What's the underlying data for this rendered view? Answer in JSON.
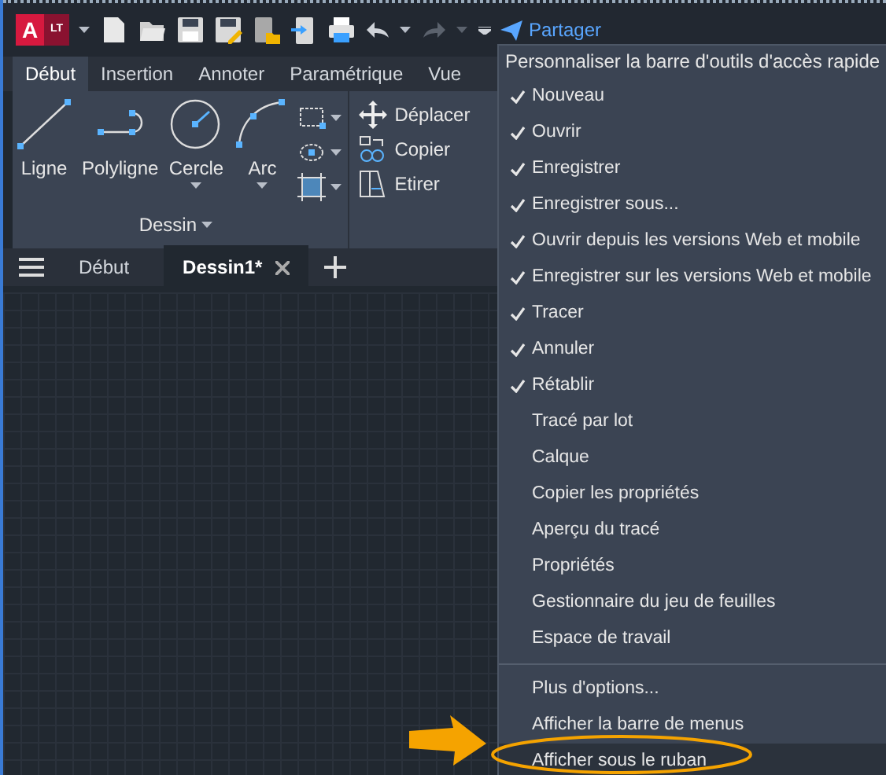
{
  "quick_access": {
    "logo": {
      "letter": "A",
      "badge": "LT"
    },
    "redo": {
      "disabled": true
    },
    "share": "Partager"
  },
  "ribbon": {
    "tabs": [
      {
        "label": "Début",
        "selected": true
      },
      {
        "label": "Insertion",
        "selected": false
      },
      {
        "label": "Annoter",
        "selected": false
      },
      {
        "label": "Paramétrique",
        "selected": false
      },
      {
        "label": "Vue",
        "selected": false
      }
    ],
    "draw_panel": {
      "title": "Dessin",
      "tools": [
        {
          "label": "Ligne",
          "has_menu": false
        },
        {
          "label": "Polyligne",
          "has_menu": false
        },
        {
          "label": "Cercle",
          "has_menu": true
        },
        {
          "label": "Arc",
          "has_menu": true
        }
      ]
    },
    "modify_panel": {
      "tools": [
        {
          "label": "Déplacer"
        },
        {
          "label": "Copier"
        },
        {
          "label": "Etirer"
        }
      ]
    }
  },
  "file_tabs": [
    {
      "label": "Début",
      "selected": false
    },
    {
      "label": "Dessin1*",
      "selected": true
    }
  ],
  "menu": {
    "title": "Personnaliser la barre d'outils d'accès rapide",
    "sections": [
      [
        {
          "label": "Nouveau",
          "checked": true,
          "highlighted": false
        },
        {
          "label": "Ouvrir",
          "checked": true,
          "highlighted": false
        },
        {
          "label": "Enregistrer",
          "checked": true,
          "highlighted": false
        },
        {
          "label": "Enregistrer sous...",
          "checked": true,
          "highlighted": false
        },
        {
          "label": "Ouvrir depuis les versions Web et mobile",
          "checked": true,
          "highlighted": false
        },
        {
          "label": "Enregistrer sur les versions Web et mobile",
          "checked": true,
          "highlighted": false
        },
        {
          "label": "Tracer",
          "checked": true,
          "highlighted": false
        },
        {
          "label": "Annuler",
          "checked": true,
          "highlighted": false
        },
        {
          "label": "Rétablir",
          "checked": true,
          "highlighted": false
        },
        {
          "label": "Tracé par lot",
          "checked": false,
          "highlighted": false
        },
        {
          "label": "Calque",
          "checked": false,
          "highlighted": false
        },
        {
          "label": "Copier les propriétés",
          "checked": false,
          "highlighted": false
        },
        {
          "label": "Aperçu du tracé",
          "checked": false,
          "highlighted": false
        },
        {
          "label": "Propriétés",
          "checked": false,
          "highlighted": false
        },
        {
          "label": "Gestionnaire du jeu de feuilles",
          "checked": false,
          "highlighted": false
        },
        {
          "label": "Espace de travail",
          "checked": false,
          "highlighted": false
        }
      ],
      [
        {
          "label": "Plus d'options...",
          "checked": false,
          "highlighted": false
        },
        {
          "label": "Afficher la barre de menus",
          "checked": false,
          "highlighted": false
        },
        {
          "label": "Afficher sous le ruban",
          "checked": false,
          "highlighted": true
        }
      ]
    ]
  }
}
